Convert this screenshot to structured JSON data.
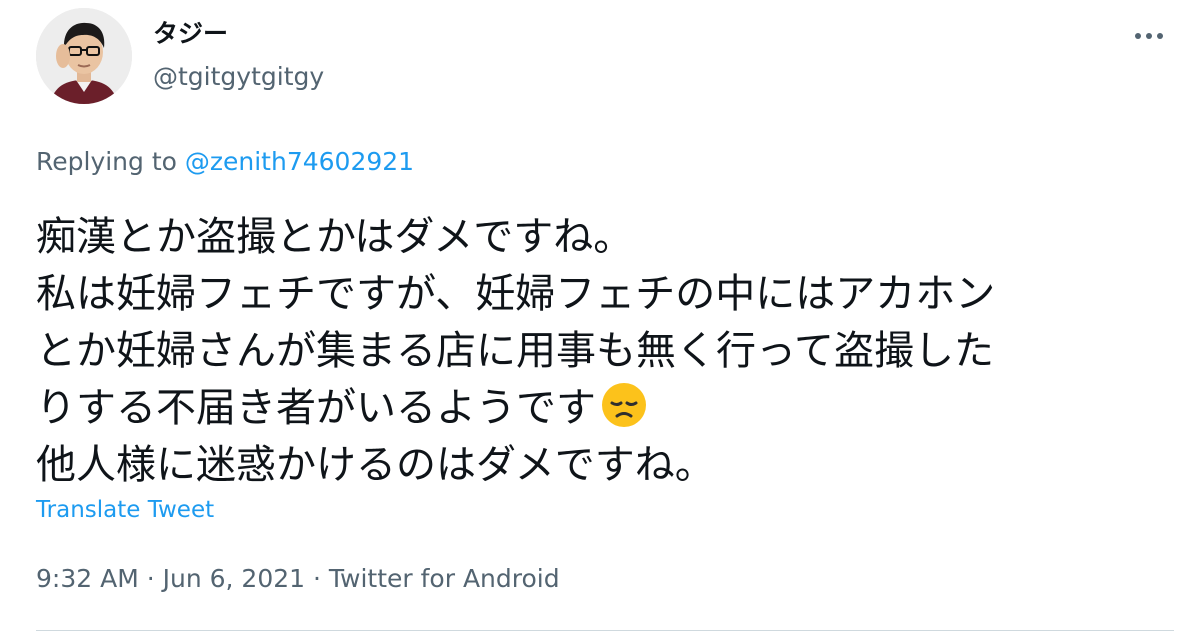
{
  "user": {
    "display_name": "タジー",
    "handle": "@tgitgytgitgy",
    "avatar_icon": "avatar-icon"
  },
  "more_icon": "more-horizontal-icon",
  "reply": {
    "prefix": "Replying to ",
    "target": "@zenith74602921"
  },
  "tweet": {
    "lines": [
      "痴漢とか盗撮とかはダメですね。",
      "私は妊婦フェチですが、妊婦フェチの中にはアカホン",
      "とか妊婦さんが集まる店に用事も無く行って盗撮した",
      "りする不届き者がいるようです",
      "他人様に迷惑かけるのはダメですね。"
    ],
    "emoji": "disappointed-face-emoji"
  },
  "translate_label": "Translate Tweet",
  "meta": {
    "time": "9:32 AM",
    "separator1": " · ",
    "date": "Jun 6, 2021",
    "separator2": " · ",
    "source": "Twitter for Android"
  },
  "colors": {
    "link": "#1d9bf0",
    "secondary": "#536471",
    "text": "#0f1419",
    "divider": "#cfd9de"
  }
}
